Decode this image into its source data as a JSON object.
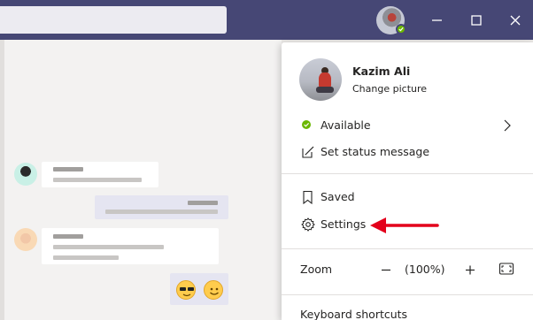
{
  "profile": {
    "name": "Kazim Ali",
    "change_picture": "Change picture"
  },
  "menu": {
    "status": "Available",
    "set_status": "Set status message",
    "saved": "Saved",
    "settings": "Settings",
    "zoom_label": "Zoom",
    "zoom_value": "(100%)",
    "keyboard_shortcuts": "Keyboard shortcuts"
  },
  "icons": {
    "presence": "check-circle-icon",
    "status_edit": "edit-status-icon",
    "saved": "bookmark-icon",
    "settings": "gear-icon",
    "zoom_out": "minus-icon",
    "zoom_in": "plus-icon",
    "fullscreen": "fullscreen-icon",
    "window_minimize": "minimize-icon",
    "window_maximize": "maximize-icon",
    "window_close": "close-icon"
  },
  "colors": {
    "titlebar": "#464775",
    "presence_available": "#6bb700",
    "annotation_arrow": "#e3001b"
  }
}
